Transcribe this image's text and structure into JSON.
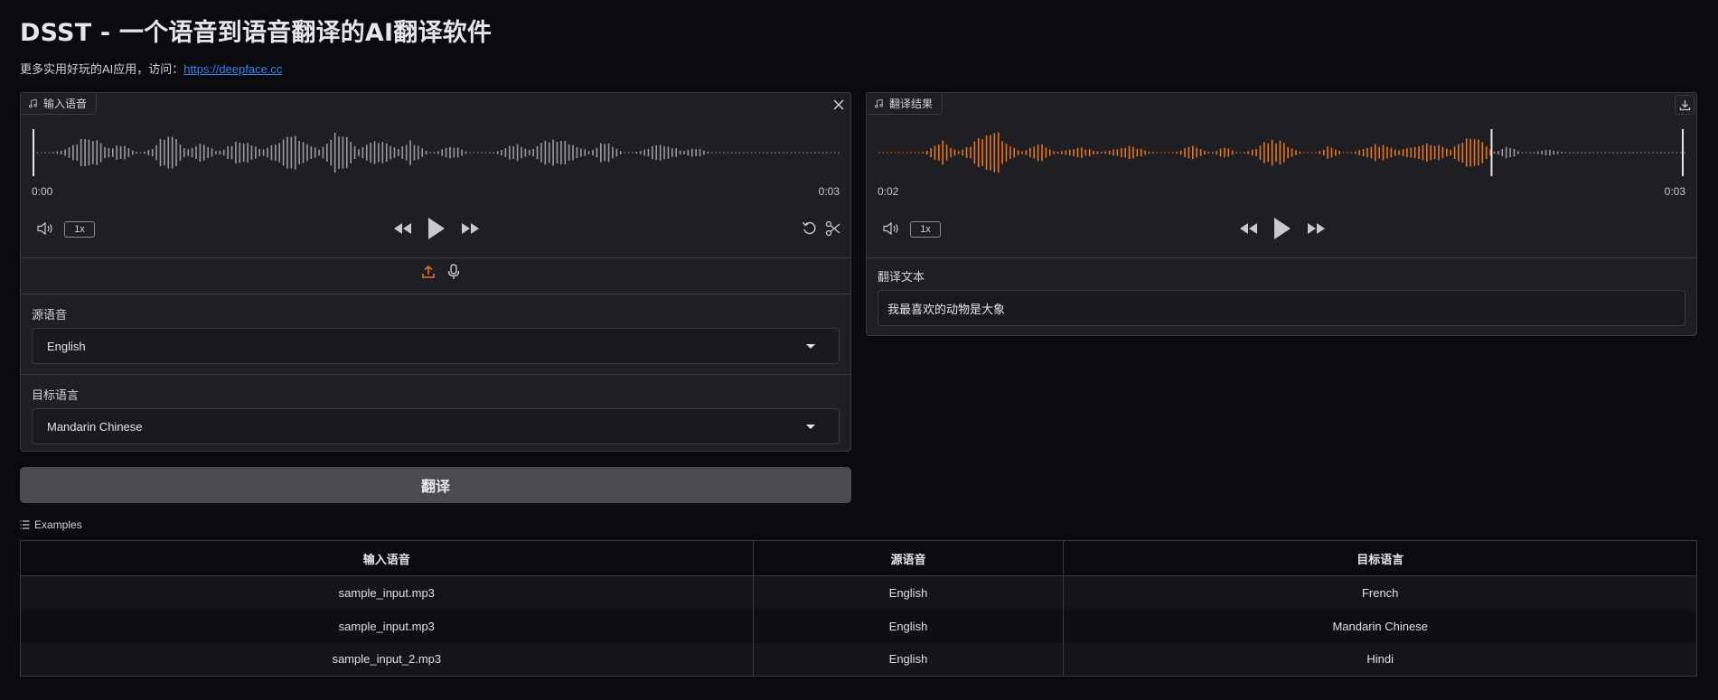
{
  "page": {
    "title": "DSST - 一个语音到语音翻译的AI翻译软件",
    "subtitle_prefix": "更多实用好玩的AI应用，访问：",
    "subtitle_link": "https://deepface.cc"
  },
  "input_audio": {
    "label": "输入语音",
    "time_start": "0:00",
    "time_end": "0:03",
    "speed": "1x",
    "wave_color": "#9a9aa0"
  },
  "source_lang": {
    "label": "源语音",
    "value": "English"
  },
  "target_lang": {
    "label": "目标语言",
    "value": "Mandarin Chinese"
  },
  "translate_button": "翻译",
  "result_audio": {
    "label": "翻译结果",
    "time_current": "0:02",
    "time_end": "0:03",
    "speed": "1x",
    "played_color": "#e8742a",
    "unplayed_color": "#9a9aa0",
    "progress": 0.76
  },
  "translated_text": {
    "label": "翻译文本",
    "value": "我最喜欢的动物是大象"
  },
  "examples": {
    "label": "Examples",
    "headers": [
      "输入语音",
      "源语音",
      "目标语言"
    ],
    "rows": [
      [
        "sample_input.mp3",
        "English",
        "French"
      ],
      [
        "sample_input.mp3",
        "English",
        "Mandarin Chinese"
      ],
      [
        "sample_input_2.mp3",
        "English",
        "Hindi"
      ]
    ]
  },
  "colors": {
    "accent": "#e8742a",
    "link": "#3b82f6"
  }
}
